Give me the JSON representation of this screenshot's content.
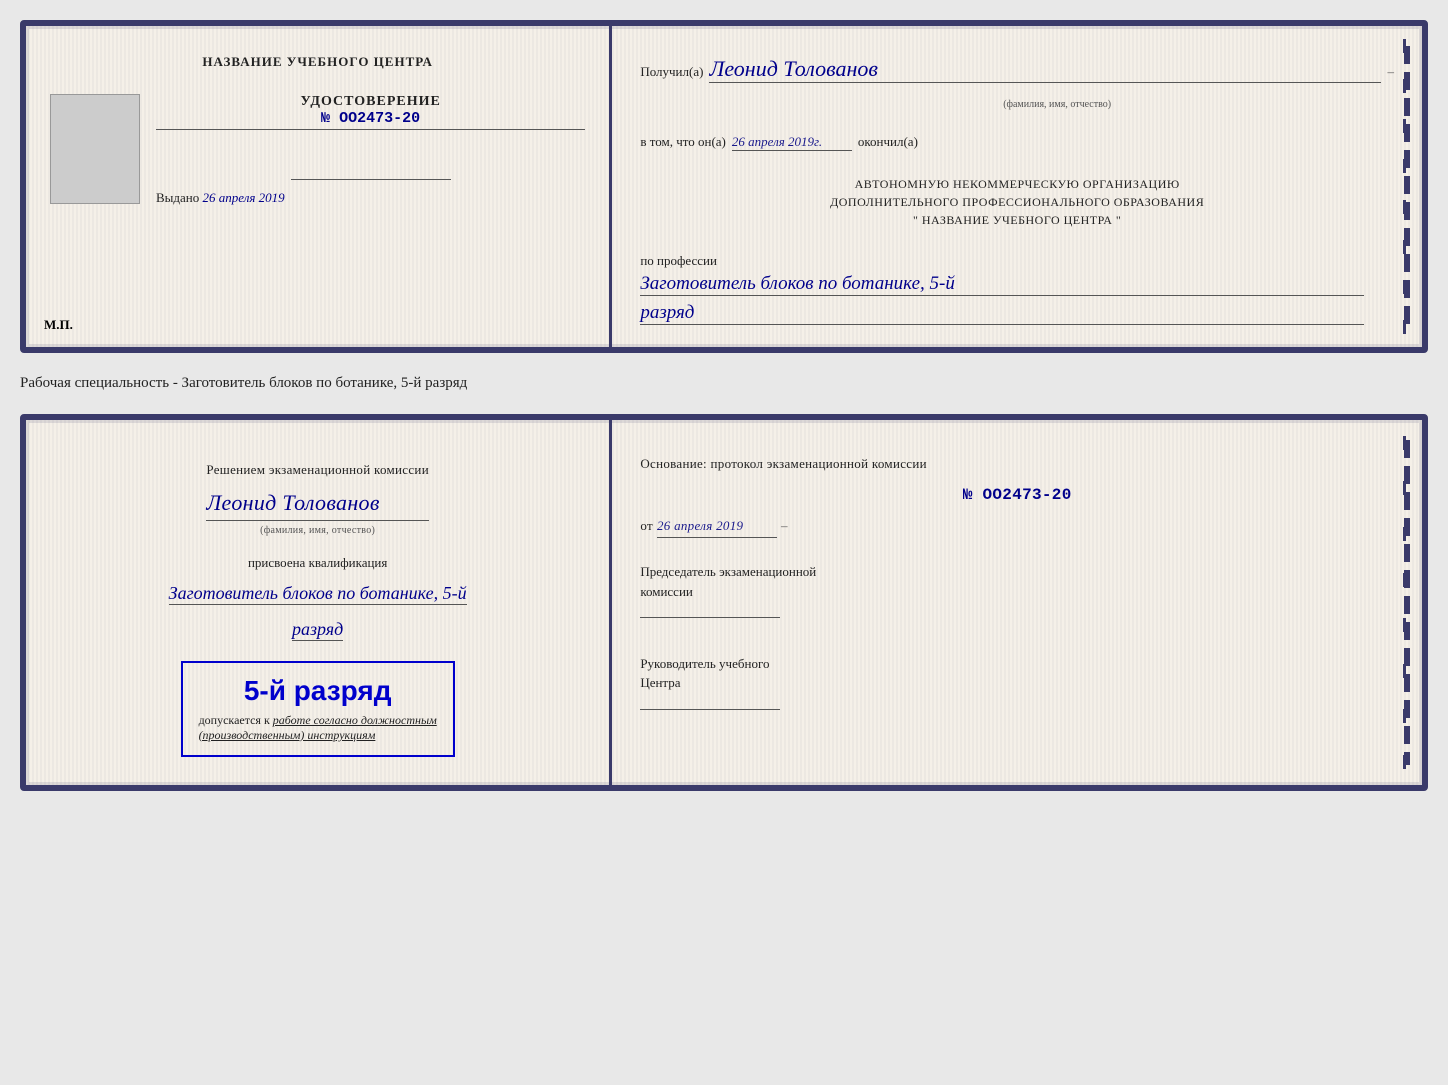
{
  "top_card": {
    "left": {
      "center_title": "НАЗВАНИЕ УЧЕБНОГО ЦЕНТРА",
      "udostoverenie_label": "УДОСТОВЕРЕНИЕ",
      "number": "№ OO2473-20",
      "vydano_label": "Выдано",
      "vydano_date": "26 апреля 2019",
      "mp_label": "М.П."
    },
    "right": {
      "poluchil_label": "Получил(а)",
      "name_handwritten": "Леонид Толованов",
      "fio_sublabel": "(фамилия, имя, отчество)",
      "v_tom_label": "в том, что он(а)",
      "date_handwritten": "26 апреля 2019г.",
      "okonchil_label": "окончил(а)",
      "avtonom_line1": "АВТОНОМНУЮ НЕКОММЕРЧЕСКУЮ ОРГАНИЗАЦИЮ",
      "avtonom_line2": "ДОПОЛНИТЕЛЬНОГО ПРОФЕССИОНАЛЬНОГО ОБРАЗОВАНИЯ",
      "avtonom_line3": "\"   НАЗВАНИЕ УЧЕБНОГО ЦЕНТРА   \"",
      "po_professii_label": "по профессии",
      "profession_handwritten": "Заготовитель блоков по ботанике, 5-й",
      "razryad_handwritten": "разряд"
    }
  },
  "specialty_label": "Рабочая специальность - Заготовитель блоков по ботанике, 5-й разряд",
  "bottom_card": {
    "left": {
      "resheniem_label": "Решением экзаменационной комиссии",
      "name_handwritten": "Леонид Толованов",
      "fio_sublabel": "(фамилия, имя, отчество)",
      "prisvoena_label": "присвоена квалификация",
      "profession_handwritten": "Заготовитель блоков по ботанике, 5-й",
      "razryad_handwritten": "разряд",
      "highlight_text": "5-й разряд",
      "dopuskaetsya_prefix": "допускается к",
      "dopuskaetsya_italic": "работе согласно должностным",
      "dopuskaetsya_italic2": "(производственным) инструкциям"
    },
    "right": {
      "osnovanie_label": "Основание: протокол экзаменационной комиссии",
      "protocol_number": "№  OO2473-20",
      "ot_label": "от",
      "ot_date": "26 апреля 2019",
      "predsedatel_line1": "Председатель экзаменационной",
      "predsedatel_line2": "комиссии",
      "rukovoditel_line1": "Руководитель учебного",
      "rukovoditel_line2": "Центра"
    }
  }
}
